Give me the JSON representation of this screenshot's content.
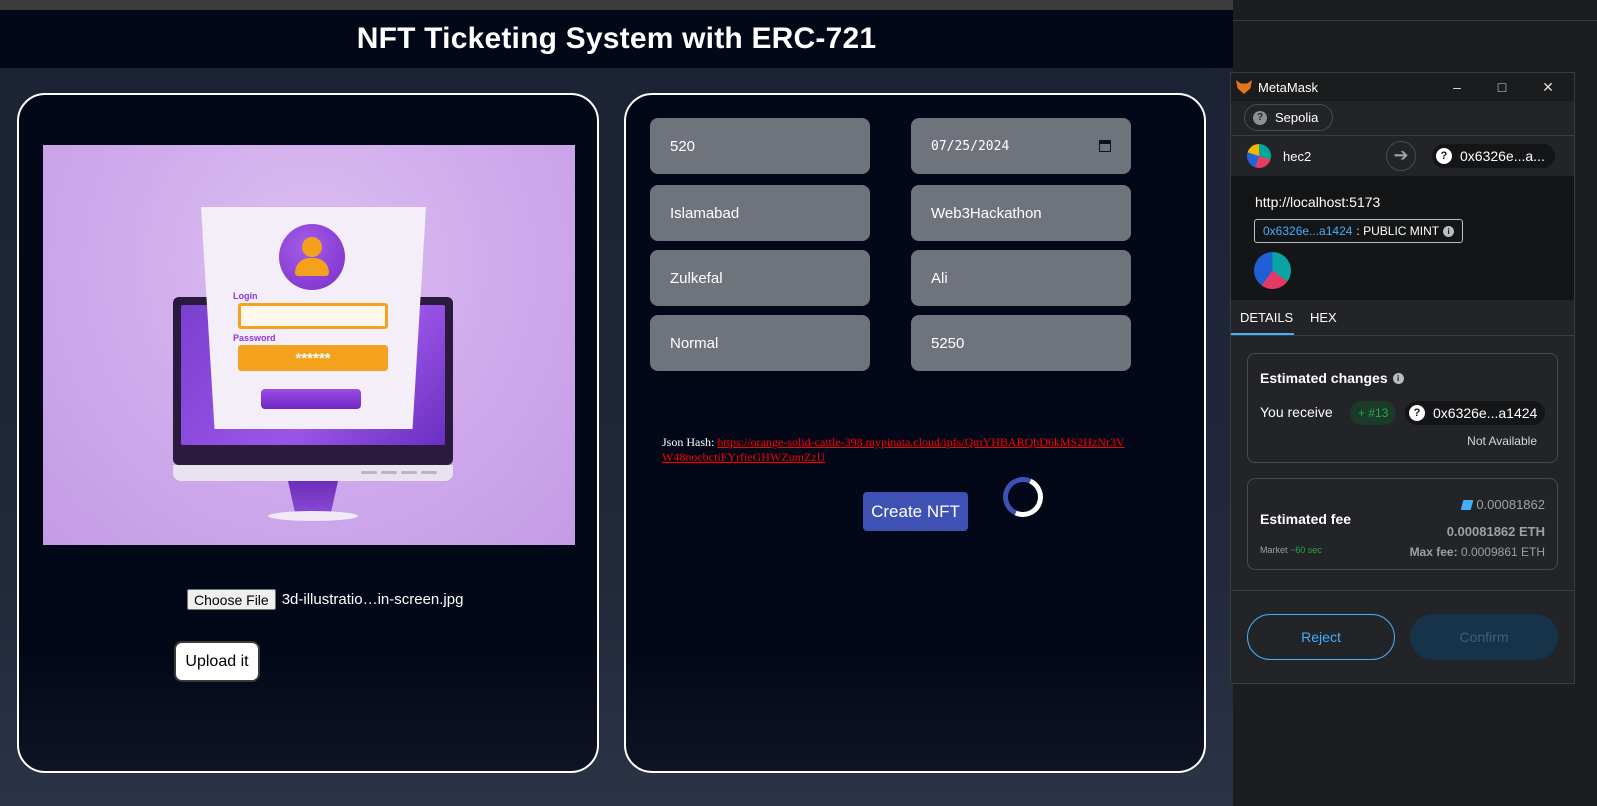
{
  "app": {
    "title": "NFT Ticketing System with ERC-721",
    "upload": {
      "choose_file_label": "Choose File",
      "file_name": "3d-illustratio…in-screen.jpg",
      "upload_label": "Upload it",
      "preview_text": {
        "login_label": "Login",
        "password_label": "Password",
        "password_mask": "******"
      }
    },
    "form": {
      "fields": [
        {
          "name": "field-1",
          "value": "520"
        },
        {
          "name": "field-2-date",
          "value": "07/25/2024"
        },
        {
          "name": "field-3",
          "value": "Islamabad"
        },
        {
          "name": "field-4",
          "value": "Web3Hackathon"
        },
        {
          "name": "field-5",
          "value": "Zulkefal"
        },
        {
          "name": "field-6",
          "value": "Ali"
        },
        {
          "name": "field-7",
          "value": "Normal"
        },
        {
          "name": "field-8",
          "value": "5250"
        }
      ],
      "json_hash_label": "Json Hash:",
      "json_hash_link": "https://orange-solid-cattle-398.mypinata.cloud/ipfs/QmYHBARQbD6kMS2HzNr3VW48nocbctiFYrfieGHWZumZzU",
      "create_label": "Create NFT"
    }
  },
  "metamask": {
    "window_title": "MetaMask",
    "network": "Sepolia",
    "account_name": "hec2",
    "to_address": "0x6326e...a...",
    "origin": "http://localhost:5173",
    "contract_address": "0x6326e...a1424",
    "method": ": PUBLIC MINT",
    "tabs": [
      "DETAILS",
      "HEX"
    ],
    "estimated_changes": {
      "title": "Estimated changes",
      "receive_label": "You receive",
      "receive_badge": "+ #13",
      "receive_address": "0x6326e...a1424",
      "receive_value": "Not Available"
    },
    "fee": {
      "title": "Estimated fee",
      "edit_value": "0.00081862",
      "eth_value": "0.00081862 ETH",
      "market_label": "Market",
      "market_time": "~60 sec",
      "max_fee_label": "Max fee:",
      "max_fee_value": "0.0009861 ETH"
    },
    "reject_label": "Reject",
    "confirm_label": "Confirm"
  },
  "colors": {
    "accent_blue": "#43aefc",
    "create_button": "#3e51b5",
    "hash_link": "#ff0000",
    "success_green": "#28a745"
  }
}
